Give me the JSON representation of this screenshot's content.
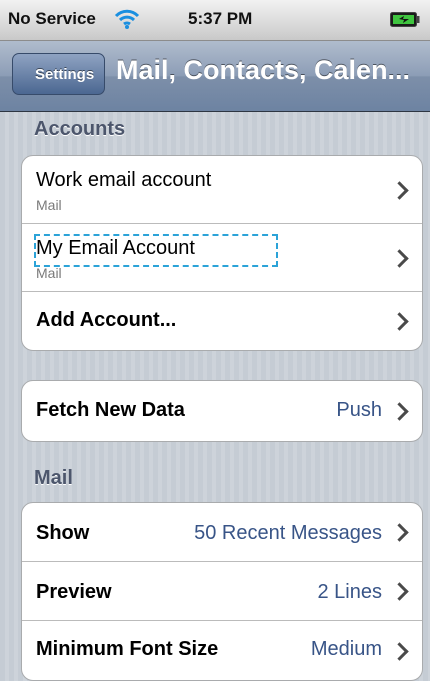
{
  "status_bar": {
    "carrier": "No Service",
    "time": "5:37 PM",
    "wifi_icon": "wifi-icon",
    "battery_icon": "battery-charging-icon"
  },
  "nav_bar": {
    "back_label": "Settings",
    "title": "Mail, Contacts, Calen..."
  },
  "accounts": {
    "header": "Accounts",
    "items": [
      {
        "label": "Work email account",
        "sublabel": "Mail"
      },
      {
        "label": "My Email Account",
        "sublabel": "Mail"
      },
      {
        "label": "Add Account..."
      }
    ]
  },
  "fetch": {
    "label": "Fetch New Data",
    "value": "Push"
  },
  "mail": {
    "header": "Mail",
    "items": [
      {
        "label": "Show",
        "value": "50 Recent Messages"
      },
      {
        "label": "Preview",
        "value": "2 Lines"
      },
      {
        "label": "Minimum Font Size",
        "value": "Medium"
      }
    ]
  },
  "colors": {
    "value_blue": "#385487",
    "nav_bar": "#6d83a2",
    "section_header": "#4c566c",
    "focus_outline": "#2ba3d8"
  }
}
